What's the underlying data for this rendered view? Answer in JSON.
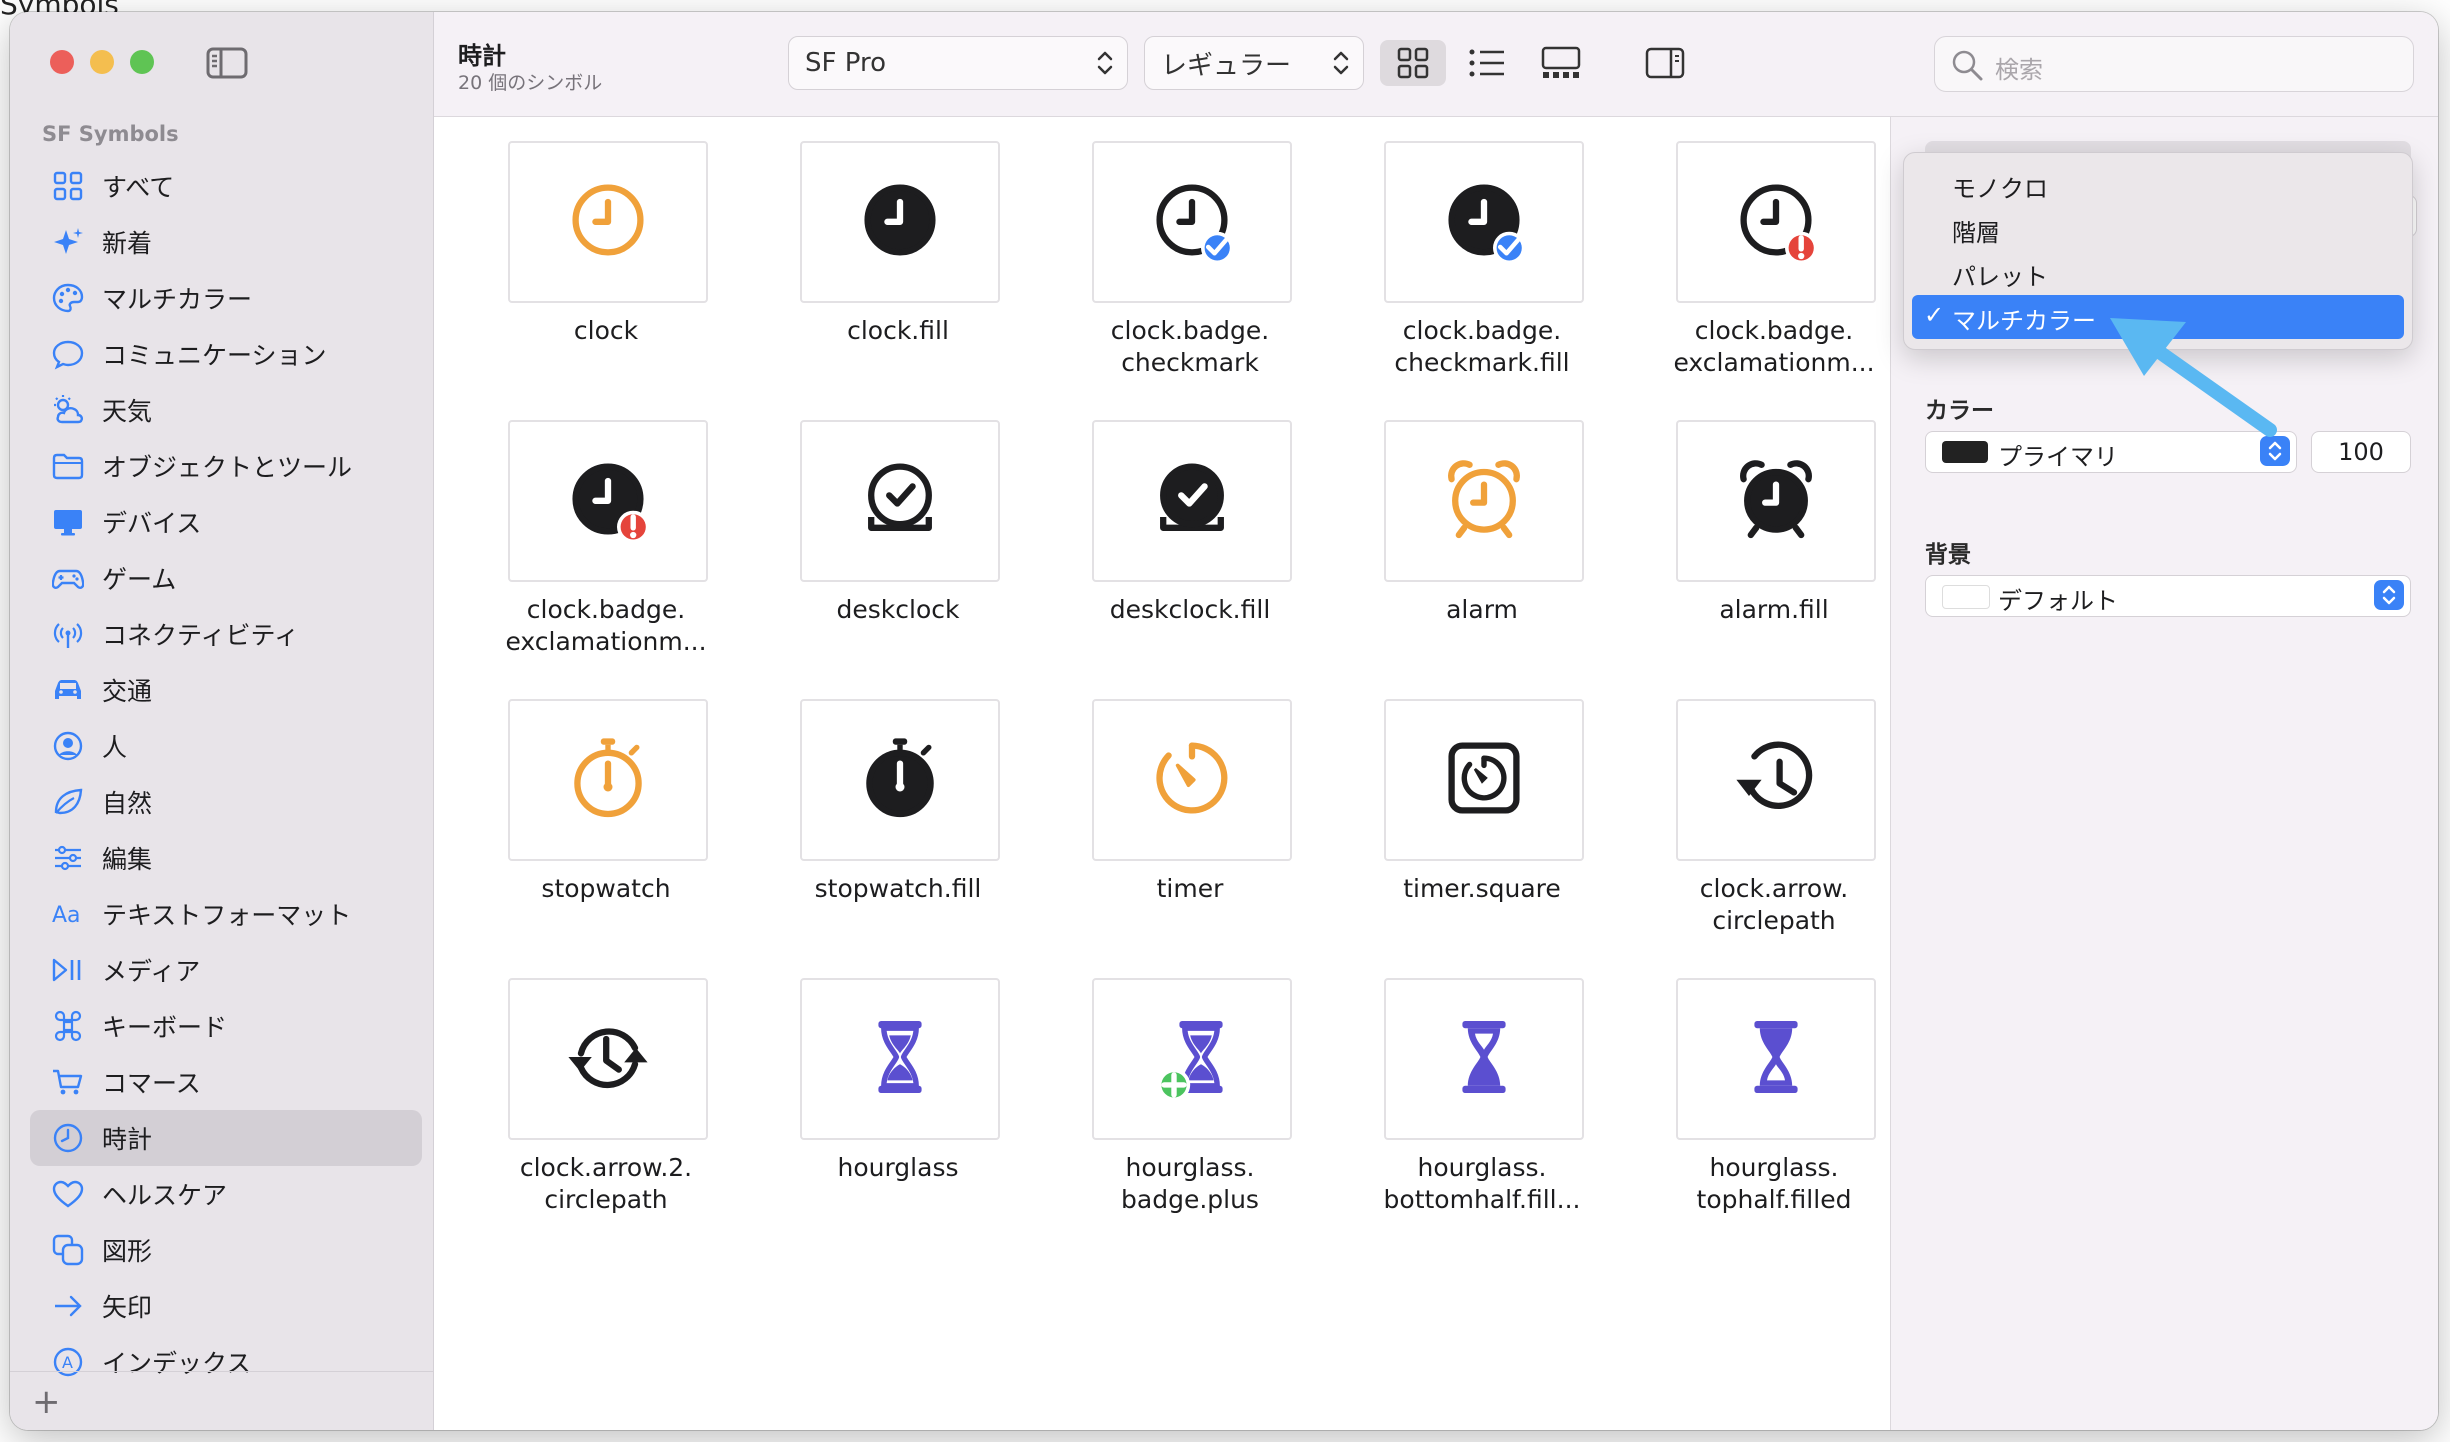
{
  "background_doc": {
    "title_fragment": "Symbols"
  },
  "sidebar": {
    "title": "SF Symbols",
    "items": [
      {
        "label": "すべて",
        "icon": "grid-icon"
      },
      {
        "label": "新着",
        "icon": "sparkles-icon"
      },
      {
        "label": "マルチカラー",
        "icon": "paintpalette-icon"
      },
      {
        "label": "コミュニケーション",
        "icon": "message-icon"
      },
      {
        "label": "天気",
        "icon": "cloud-sun-icon"
      },
      {
        "label": "オブジェクトとツール",
        "icon": "folder-icon"
      },
      {
        "label": "デバイス",
        "icon": "desktop-icon"
      },
      {
        "label": "ゲーム",
        "icon": "gamecontroller-icon"
      },
      {
        "label": "コネクティビティ",
        "icon": "antenna-icon"
      },
      {
        "label": "交通",
        "icon": "car-icon"
      },
      {
        "label": "人",
        "icon": "person-circle-icon"
      },
      {
        "label": "自然",
        "icon": "leaf-icon"
      },
      {
        "label": "編集",
        "icon": "sliders-icon"
      },
      {
        "label": "テキストフォーマット",
        "icon": "textformat-icon"
      },
      {
        "label": "メディア",
        "icon": "playpause-icon"
      },
      {
        "label": "キーボード",
        "icon": "command-icon"
      },
      {
        "label": "コマース",
        "icon": "cart-icon"
      },
      {
        "label": "時計",
        "icon": "clock-icon",
        "selected": true
      },
      {
        "label": "ヘルスケア",
        "icon": "heart-icon"
      },
      {
        "label": "図形",
        "icon": "shapes-icon"
      },
      {
        "label": "矢印",
        "icon": "arrow-right-icon"
      },
      {
        "label": "インデックス",
        "icon": "a-circle-icon"
      }
    ],
    "add_label": "+"
  },
  "toolbar": {
    "title": "時計",
    "subtitle": "20 個のシンボル",
    "font_popup": "SF Pro",
    "weight_popup": "レギュラー",
    "search_placeholder": "検索"
  },
  "symbols": [
    {
      "name": "clock",
      "kind": "clock",
      "fill": false,
      "color": "#f0a13a"
    },
    {
      "name": "clock.fill",
      "kind": "clock",
      "fill": true,
      "color": "#1d1d1f"
    },
    {
      "name": "clock.badge.\ncheckmark",
      "kind": "clock-check",
      "fill": false,
      "color": "#1d1d1f"
    },
    {
      "name": "clock.badge.\ncheckmark.fill",
      "kind": "clock-check",
      "fill": true,
      "color": "#1d1d1f"
    },
    {
      "name": "clock.badge.\nexclamationm...",
      "kind": "clock-excl",
      "fill": false,
      "color": "#1d1d1f"
    },
    {
      "name": "clock.badge.\nexclamationm...",
      "kind": "clock-excl",
      "fill": true,
      "color": "#1d1d1f"
    },
    {
      "name": "deskclock",
      "kind": "deskclock",
      "fill": false,
      "color": "#1d1d1f"
    },
    {
      "name": "deskclock.fill",
      "kind": "deskclock",
      "fill": true,
      "color": "#1d1d1f"
    },
    {
      "name": "alarm",
      "kind": "alarm",
      "fill": false,
      "color": "#f0a13a"
    },
    {
      "name": "alarm.fill",
      "kind": "alarm",
      "fill": true,
      "color": "#1d1d1f"
    },
    {
      "name": "stopwatch",
      "kind": "stopwatch",
      "fill": false,
      "color": "#f0a13a"
    },
    {
      "name": "stopwatch.fill",
      "kind": "stopwatch",
      "fill": true,
      "color": "#1d1d1f"
    },
    {
      "name": "timer",
      "kind": "timer",
      "fill": false,
      "color": "#f0a13a"
    },
    {
      "name": "timer.square",
      "kind": "timer-square",
      "fill": false,
      "color": "#1d1d1f"
    },
    {
      "name": "clock.arrow.\ncirclepath",
      "kind": "clock-arrow",
      "fill": false,
      "color": "#1d1d1f"
    },
    {
      "name": "clock.arrow.2.\ncirclepath",
      "kind": "clock-arrow2",
      "fill": false,
      "color": "#1d1d1f"
    },
    {
      "name": "hourglass",
      "kind": "hourglass",
      "fill": false,
      "color": "#5b4fd0"
    },
    {
      "name": "hourglass.\nbadge.plus",
      "kind": "hourglass-plus",
      "fill": false,
      "color": "#5b4fd0"
    },
    {
      "name": "hourglass.\nbottomhalf.fill...",
      "kind": "hourglass-bottom",
      "fill": true,
      "color": "#5b4fd0"
    },
    {
      "name": "hourglass.\ntophalf.filled",
      "kind": "hourglass-top",
      "fill": true,
      "color": "#5b4fd0"
    }
  ],
  "inspector": {
    "color_label": "カラー",
    "color_value": "プライマリ",
    "opacity": "100",
    "background_label": "背景",
    "background_value": "デフォルト"
  },
  "rendering_menu": {
    "items": [
      {
        "label": "モノクロ",
        "selected": false
      },
      {
        "label": "階層",
        "selected": false
      },
      {
        "label": "パレット",
        "selected": false
      },
      {
        "label": "マルチカラー",
        "selected": true
      }
    ],
    "check": "✓"
  },
  "colors": {
    "accent": "#3a82f7",
    "orange": "#f0a13a",
    "indigo": "#5b4fd0",
    "badge_red": "#e5443b",
    "badge_green": "#4cc45f",
    "annotation_arrow": "#5ab8f2"
  }
}
